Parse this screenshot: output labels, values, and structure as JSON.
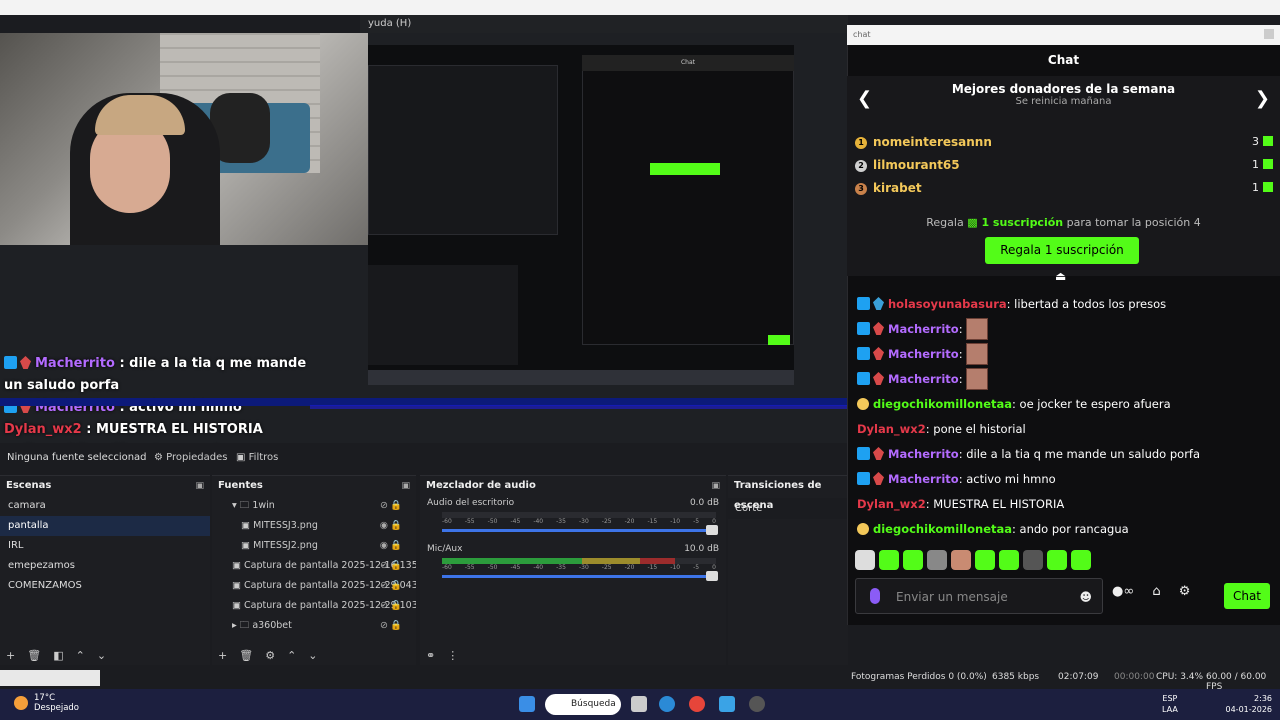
{
  "window": {
    "title_fragment": "yuda (H)"
  },
  "preview": {
    "overlay_chat": [
      {
        "user": "Macherrito",
        "text": " : dile a la tia q me mande un saludo porfa",
        "color": "#b36bff",
        "badges": [
          "x",
          "s"
        ]
      },
      {
        "user": "Macherrito",
        "text": " : activo mi hmno",
        "color": "#b36bff",
        "badges": [
          "x",
          "s"
        ]
      },
      {
        "user": "Dylan_wx2",
        "text": " : MUESTRA EL HISTORIA",
        "color": "#e5394a",
        "badges": []
      },
      {
        "user": "diegochikomillonetaa",
        "text": " : ando por rancagua",
        "color": "#53fc18",
        "badges": [
          "y"
        ]
      }
    ]
  },
  "source_bar": {
    "no_source": "Ninguna fuente seleccionad",
    "properties": "Propiedades",
    "filters": "Filtros"
  },
  "scenes": {
    "title": "Escenas",
    "items": [
      "camara",
      "pantalla",
      "IRL",
      "emepezamos",
      "COMENZAMOS"
    ],
    "selected": "pantalla"
  },
  "sources": {
    "title": "Fuentes",
    "items": [
      "1win",
      "MITESSJ3.png",
      "MITESSJ2.png",
      "Captura de pantalla 2025-12-16 135",
      "Captura de pantalla 2025-12-29 043",
      "Captura de pantalla 2025-12-29 103",
      "a360bet"
    ]
  },
  "mixer": {
    "title": "Mezclador de audio",
    "channels": [
      {
        "name": "Audio del escritorio",
        "db": "0.0 dB",
        "level": 0.0
      },
      {
        "name": "Mic/Aux",
        "db": "10.0 dB",
        "level": 0.85
      }
    ],
    "scale": [
      "-60",
      "-55",
      "-50",
      "-45",
      "-40",
      "-35",
      "-30",
      "-25",
      "-20",
      "-15",
      "-10",
      "-5",
      "0"
    ]
  },
  "transitions": {
    "title": "Transiciones de escena",
    "current": "Corte"
  },
  "chat": {
    "addr": "chat",
    "title": "Chat",
    "donors_title": "Mejores donadores de la semana",
    "donors_subtitle": "Se reinicia mañana",
    "donors": [
      {
        "name": "nomeinteresannn",
        "count": "3",
        "rank": "1"
      },
      {
        "name": "lilmourant65",
        "count": "1",
        "rank": "2"
      },
      {
        "name": "kirabet",
        "count": "1",
        "rank": "3"
      }
    ],
    "gift_text_pre": "Regala ",
    "gift_text_bold": "1 suscripción",
    "gift_text_post": " para tomar la posición 4",
    "gift_button": "Regala 1 suscripción",
    "messages": [
      {
        "user": "holasoyunabasura",
        "color": "#e5394a",
        "text": ": libertad a todos los presos",
        "badges": [
          "x",
          "s2"
        ]
      },
      {
        "user": "Macherrito",
        "color": "#b36bff",
        "text": ":",
        "emote": true,
        "badges": [
          "x",
          "s"
        ]
      },
      {
        "user": "Macherrito",
        "color": "#b36bff",
        "text": ":",
        "emote": true,
        "badges": [
          "x",
          "s"
        ]
      },
      {
        "user": "Macherrito",
        "color": "#b36bff",
        "text": ":",
        "emote": true,
        "badges": [
          "x",
          "s"
        ]
      },
      {
        "user": "diegochikomillonetaa",
        "color": "#53fc18",
        "text": ": oe jocker te espero afuera",
        "badges": [
          "y"
        ]
      },
      {
        "user": "Dylan_wx2",
        "color": "#e5394a",
        "text": ": pone el historial",
        "badges": []
      },
      {
        "user": "Macherrito",
        "color": "#b36bff",
        "text": ": dile a la tia q me mande un saludo porfa",
        "badges": [
          "x",
          "s"
        ]
      },
      {
        "user": "Macherrito",
        "color": "#b36bff",
        "text": ": activo mi hmno",
        "badges": [
          "x",
          "s"
        ]
      },
      {
        "user": "Dylan_wx2",
        "color": "#e5394a",
        "text": ": MUESTRA EL HISTORIA",
        "badges": []
      },
      {
        "user": "diegochikomillonetaa",
        "color": "#53fc18",
        "text": ": ando por rancagua",
        "badges": [
          "y"
        ]
      }
    ],
    "input_placeholder": "Enviar un mensaje",
    "send_label": "Chat"
  },
  "status": {
    "frames_lost": "Fotogramas Perdidos 0 (0.0%)",
    "kbps": "6385 kbps",
    "live_time": "02:07:09",
    "rec_time": "00:00:00",
    "cpu": "CPU: 3.4%",
    "fps": "60.00 / 60.00 FPS"
  },
  "taskbar": {
    "temp": "17°C",
    "weather": "Despejado",
    "search": "Búsqueda",
    "lang1": "ESP",
    "lang2": "LAA",
    "time": "2:36",
    "date": "04-01-2026"
  },
  "colors": {
    "kick_green": "#53fc18",
    "accent_blue": "#3d74e8"
  }
}
